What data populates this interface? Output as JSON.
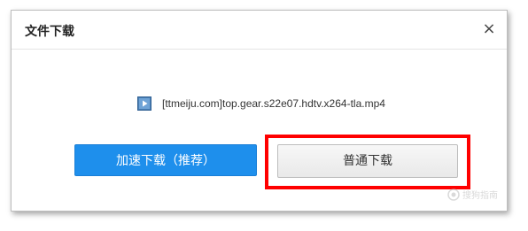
{
  "dialog": {
    "title": "文件下载",
    "close_label": "×"
  },
  "file": {
    "icon": "video-file-icon",
    "name": "[ttmeiju.com]top.gear.s22e07.hdtv.x264-tla.mp4"
  },
  "buttons": {
    "fast_download": "加速下载（推荐）",
    "normal_download": "普通下载"
  },
  "watermark": {
    "text": "搜狗指南"
  },
  "colors": {
    "accent": "#1e8fec",
    "highlight": "#ff0000"
  }
}
